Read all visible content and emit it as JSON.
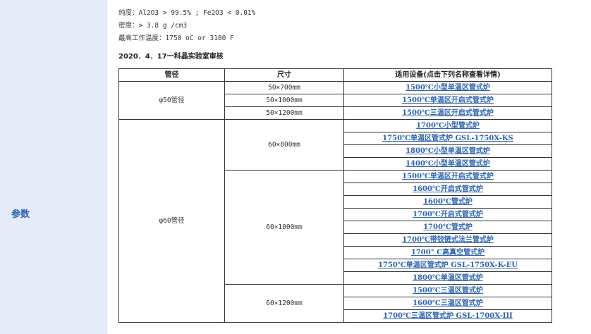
{
  "sidebar": {
    "label": "参数"
  },
  "specs": [
    "纯度：Al2O3 > 99.5% ; Fe2O3 < 0.01%",
    "密度：> 3.8 g /cm3",
    "最高工作温度：1750 oC or 3180 F"
  ],
  "audit_title": "2020．4．17一科晶实验室审核",
  "table": {
    "headers": [
      "管径",
      "尺寸",
      "适用设备(点击下列名称查看详情)"
    ],
    "groups": [
      {
        "diameter": "φ50管径",
        "sizes": [
          {
            "size": "50×700mm",
            "equipment": [
              "1500℃小型单温区管式炉"
            ]
          },
          {
            "size": "50×1000mm",
            "equipment": [
              "1500℃单温区开启式管式炉"
            ]
          },
          {
            "size": "50×1200mm",
            "equipment": [
              "1500℃三温区开启式管式炉"
            ]
          }
        ]
      },
      {
        "diameter": "φ60管径",
        "sizes": [
          {
            "size": "60×800mm",
            "equipment": [
              "1700℃小型管式炉",
              "1750℃单温区管式炉 GSL-1750X-KS",
              "1800℃小型单温区管式炉",
              "1400℃小型单温区管式炉"
            ]
          },
          {
            "size": "60×1000mm",
            "equipment": [
              "1500℃单温区开启式管式炉",
              "1600℃开启式管式炉",
              "1600℃管式炉",
              "1700℃开启式管式炉",
              "1700℃管式炉",
              "1700℃带铰链式法兰管式炉",
              "1700° C高真空管式炉",
              "1750℃单温区管式炉 GSL-1750X-K-EU",
              "1800℃单温区管式炉"
            ]
          },
          {
            "size": "60×1200mm",
            "equipment": [
              "1500℃三温区管式炉",
              "1600℃三温区管式炉",
              "1700℃三温区管式炉 GSL-1700X-III"
            ]
          }
        ]
      }
    ]
  }
}
